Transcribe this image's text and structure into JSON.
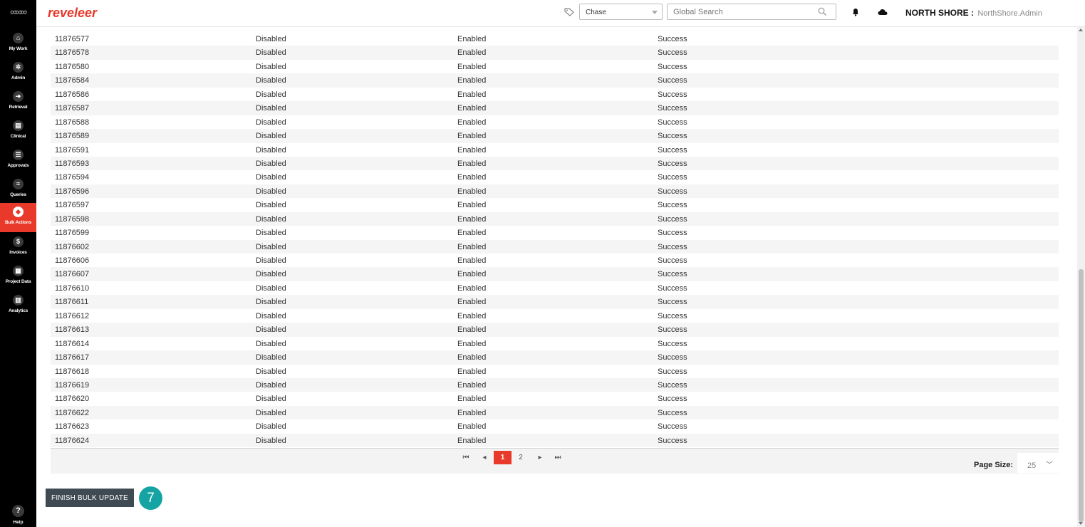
{
  "app": {
    "brand": "reveleer",
    "chase_select": "Chase",
    "search_placeholder": "Global Search",
    "org_name": "NORTH SHORE",
    "org_sep": " : ",
    "user": "NorthShore.Admin",
    "accent_color": "#e8392b"
  },
  "sidebar": {
    "items": [
      {
        "label": "My Work",
        "icon": "home-icon",
        "glyph": "⌂"
      },
      {
        "label": "Admin",
        "icon": "gear-icon",
        "glyph": "✲"
      },
      {
        "label": "Retrieval",
        "icon": "arrow-right-icon",
        "glyph": "➜"
      },
      {
        "label": "Clinical",
        "icon": "clipboard-icon",
        "glyph": "▤"
      },
      {
        "label": "Approvals",
        "icon": "checklist-icon",
        "glyph": "☰"
      },
      {
        "label": "Queries",
        "icon": "list-icon",
        "glyph": "≡"
      },
      {
        "label": "Bulk Actions",
        "icon": "layers-icon",
        "glyph": "◆"
      },
      {
        "label": "Invoices",
        "icon": "dollar-icon",
        "glyph": "$"
      },
      {
        "label": "Project Data",
        "icon": "folder-icon",
        "glyph": "▦"
      },
      {
        "label": "Analytics",
        "icon": "chart-icon",
        "glyph": "▥"
      }
    ],
    "active_index": 6,
    "help_label": "Help"
  },
  "table": {
    "rows": [
      [
        "11876577",
        "Disabled",
        "Enabled",
        "Success"
      ],
      [
        "11876578",
        "Disabled",
        "Enabled",
        "Success"
      ],
      [
        "11876580",
        "Disabled",
        "Enabled",
        "Success"
      ],
      [
        "11876584",
        "Disabled",
        "Enabled",
        "Success"
      ],
      [
        "11876586",
        "Disabled",
        "Enabled",
        "Success"
      ],
      [
        "11876587",
        "Disabled",
        "Enabled",
        "Success"
      ],
      [
        "11876588",
        "Disabled",
        "Enabled",
        "Success"
      ],
      [
        "11876589",
        "Disabled",
        "Enabled",
        "Success"
      ],
      [
        "11876591",
        "Disabled",
        "Enabled",
        "Success"
      ],
      [
        "11876593",
        "Disabled",
        "Enabled",
        "Success"
      ],
      [
        "11876594",
        "Disabled",
        "Enabled",
        "Success"
      ],
      [
        "11876596",
        "Disabled",
        "Enabled",
        "Success"
      ],
      [
        "11876597",
        "Disabled",
        "Enabled",
        "Success"
      ],
      [
        "11876598",
        "Disabled",
        "Enabled",
        "Success"
      ],
      [
        "11876599",
        "Disabled",
        "Enabled",
        "Success"
      ],
      [
        "11876602",
        "Disabled",
        "Enabled",
        "Success"
      ],
      [
        "11876606",
        "Disabled",
        "Enabled",
        "Success"
      ],
      [
        "11876607",
        "Disabled",
        "Enabled",
        "Success"
      ],
      [
        "11876610",
        "Disabled",
        "Enabled",
        "Success"
      ],
      [
        "11876611",
        "Disabled",
        "Enabled",
        "Success"
      ],
      [
        "11876612",
        "Disabled",
        "Enabled",
        "Success"
      ],
      [
        "11876613",
        "Disabled",
        "Enabled",
        "Success"
      ],
      [
        "11876614",
        "Disabled",
        "Enabled",
        "Success"
      ],
      [
        "11876617",
        "Disabled",
        "Enabled",
        "Success"
      ],
      [
        "11876618",
        "Disabled",
        "Enabled",
        "Success"
      ],
      [
        "11876619",
        "Disabled",
        "Enabled",
        "Success"
      ],
      [
        "11876620",
        "Disabled",
        "Enabled",
        "Success"
      ],
      [
        "11876622",
        "Disabled",
        "Enabled",
        "Success"
      ],
      [
        "11876623",
        "Disabled",
        "Enabled",
        "Success"
      ],
      [
        "11876624",
        "Disabled",
        "Enabled",
        "Success"
      ]
    ]
  },
  "pager": {
    "first": "⏮",
    "prev": "◂",
    "current_page": "1",
    "next_page": "2",
    "next": "▸",
    "last": "⏭",
    "page_size_label": "Page Size:",
    "page_size": "25"
  },
  "actions": {
    "finish_label": "FINISH BULK UPDATE",
    "step_number": "7",
    "step_color": "#15a3a3"
  }
}
